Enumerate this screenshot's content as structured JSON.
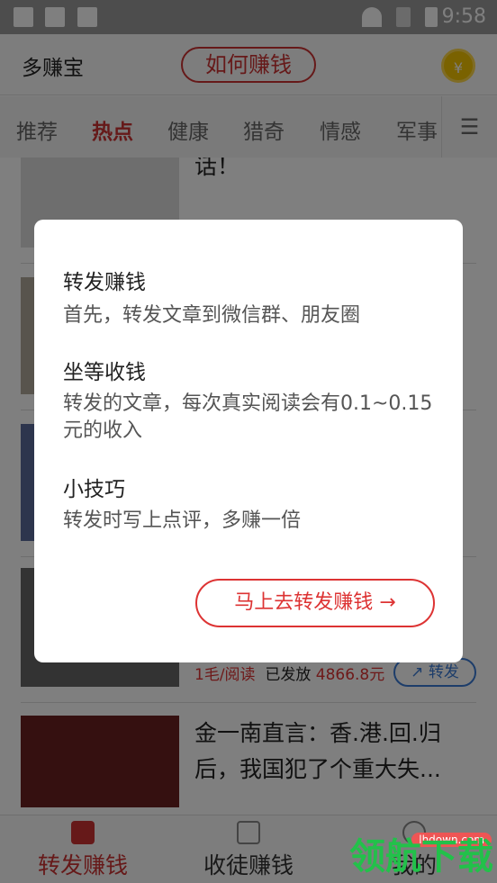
{
  "status_bar": {
    "time": "9:58",
    "icons": [
      "app-notification-icon",
      "app-notification-icon",
      "bag-icon",
      "wifi-icon",
      "no-sim-icon",
      "battery-charging-icon"
    ]
  },
  "header": {
    "app_name": "多赚宝",
    "how_to_earn": "如何赚钱",
    "coin_symbol": "¥"
  },
  "tabs": [
    {
      "label": "推荐"
    },
    {
      "label": "热点",
      "active": true
    },
    {
      "label": "健康"
    },
    {
      "label": "猎奇"
    },
    {
      "label": "情感"
    },
    {
      "label": "军事"
    }
  ],
  "menu_icon": "☰",
  "feed": [
    {
      "title": "话！"
    },
    {
      "title": ""
    },
    {
      "title": ""
    },
    {
      "title": "",
      "rate": "1毛/阅读",
      "paid_label": "已发放",
      "paid_amount": "4866.8元",
      "share": "转发"
    },
    {
      "title": "金一南直言：香.港.回.归后，我国犯了个重大失..."
    }
  ],
  "dialog": {
    "h1": "转发赚钱",
    "t1": "首先，转发文章到微信群、朋友圈",
    "h2": "坐等收钱",
    "t2": "转发的文章，每次真实阅读会有0.1~0.15元的收入",
    "h3": "小技巧",
    "t3": "转发时写上点评，多赚一倍",
    "button": "马上去转发赚钱 →"
  },
  "bottom_nav": [
    {
      "label": "转发赚钱",
      "active": true
    },
    {
      "label": "收徒赚钱"
    },
    {
      "label": "我的"
    }
  ],
  "watermark": {
    "text": "领航下载",
    "url": "lhdown.com"
  },
  "colors": {
    "accent": "#cc3333",
    "link": "#3a7bd5"
  }
}
